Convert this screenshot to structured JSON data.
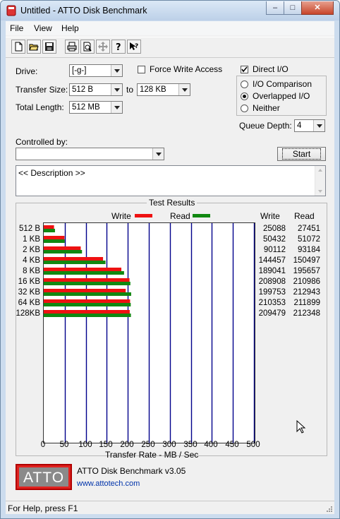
{
  "window": {
    "title": "Untitled - ATTO Disk Benchmark",
    "min": "–",
    "max": "□",
    "close": "✕"
  },
  "menu": [
    "File",
    "View",
    "Help"
  ],
  "toolbar": [
    "new-icon",
    "open-icon",
    "save-icon",
    "print-icon",
    "print-preview-icon",
    "move-icon",
    "help-icon",
    "context-help-icon"
  ],
  "drive": {
    "label": "Drive:",
    "value": "[-g-]"
  },
  "force_write": {
    "label": "Force Write Access",
    "checked": false
  },
  "direct_io": {
    "label": "Direct I/O",
    "checked": true
  },
  "transfer_size": {
    "label": "Transfer Size:",
    "from": "512 B",
    "to_label": "to",
    "to": "128 KB"
  },
  "total_length": {
    "label": "Total Length:",
    "value": "512 MB"
  },
  "io_mode": {
    "options": [
      "I/O Comparison",
      "Overlapped I/O",
      "Neither"
    ],
    "selected": "Overlapped I/O"
  },
  "queue_depth": {
    "label": "Queue Depth:",
    "value": "4"
  },
  "controlled_by": {
    "label": "Controlled by:",
    "value": ""
  },
  "start_button": "Start",
  "description": "<< Description >>",
  "results": {
    "title": "Test Results",
    "legend_write": "Write",
    "legend_read": "Read",
    "col_write": "Write",
    "col_read": "Read",
    "rows": [
      {
        "size": "512 B",
        "write": "25088",
        "read": "27451"
      },
      {
        "size": "1 KB",
        "write": "50432",
        "read": "51072"
      },
      {
        "size": "2 KB",
        "write": "90112",
        "read": "93184"
      },
      {
        "size": "4 KB",
        "write": "144457",
        "read": "150497"
      },
      {
        "size": "8 KB",
        "write": "189041",
        "read": "195657"
      },
      {
        "size": "16 KB",
        "write": "208908",
        "read": "210986"
      },
      {
        "size": "32 KB",
        "write": "199753",
        "read": "212943"
      },
      {
        "size": "64 KB",
        "write": "210353",
        "read": "211899"
      },
      {
        "size": "128KB",
        "write": "209479",
        "read": "212348"
      }
    ],
    "xlabel": "Transfer Rate - MB / Sec",
    "xticks": [
      "0",
      "50",
      "100",
      "150",
      "200",
      "250",
      "300",
      "350",
      "400",
      "450",
      "500"
    ],
    "write_color": "#ee1111",
    "read_color": "#118811",
    "grid_color": "#00008b"
  },
  "chart_data": {
    "type": "bar",
    "categories": [
      "512 B",
      "1 KB",
      "2 KB",
      "4 KB",
      "8 KB",
      "16 KB",
      "32 KB",
      "64 KB",
      "128KB"
    ],
    "series": [
      {
        "name": "Write",
        "values": [
          24.5,
          49.25,
          88,
          141.07,
          184.61,
          204.01,
          195.07,
          205.42,
          204.57
        ]
      },
      {
        "name": "Read",
        "values": [
          26.81,
          49.88,
          91,
          146.97,
          191.07,
          206.04,
          207.95,
          206.93,
          207.37
        ]
      }
    ],
    "xlabel": "Transfer Rate - MB / Sec",
    "xlim": [
      0,
      500
    ],
    "grid": true,
    "legend": "top"
  },
  "logo": {
    "brand": "ATTO",
    "product": "ATTO Disk Benchmark v3.05",
    "url": "www.attotech.com"
  },
  "status": "For Help, press F1"
}
